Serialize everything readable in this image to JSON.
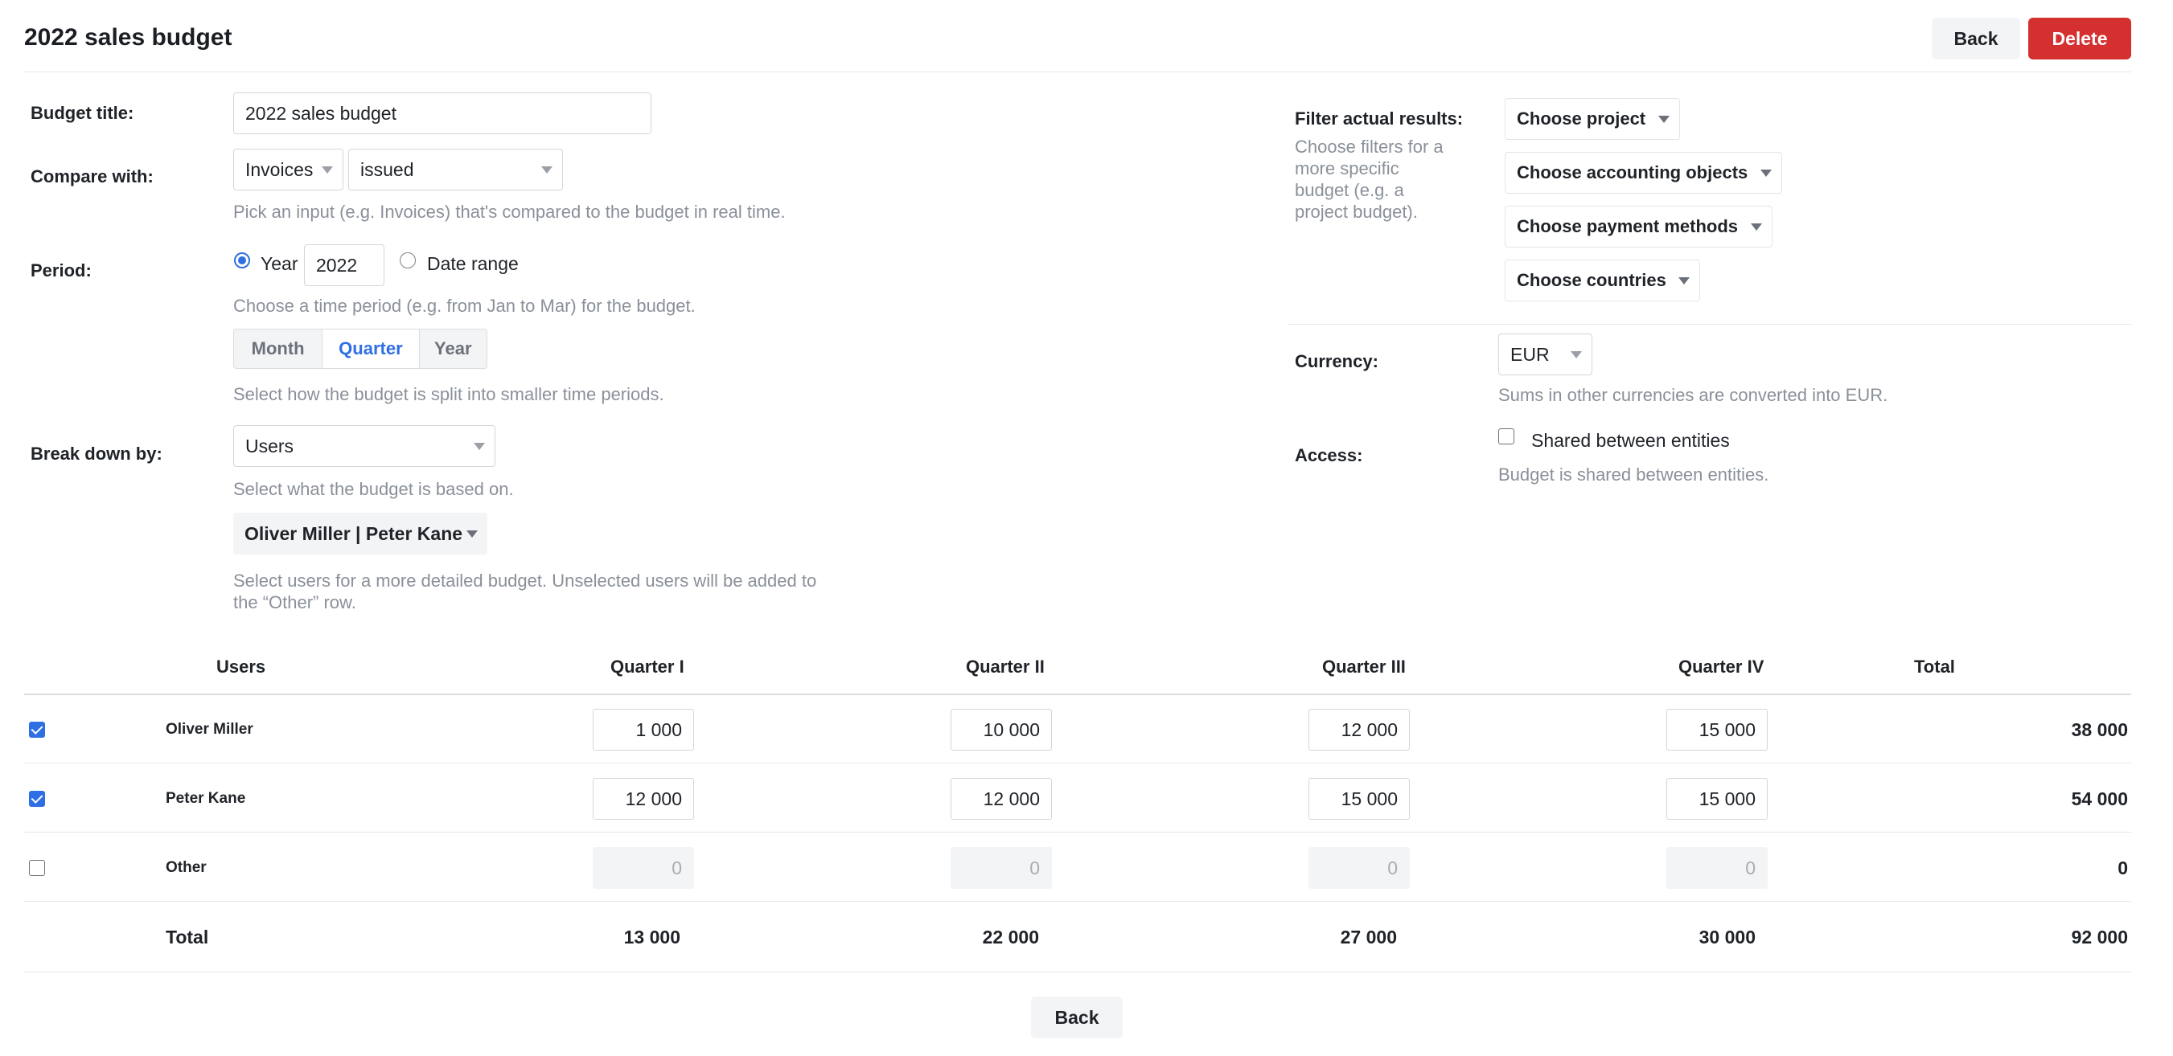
{
  "header": {
    "title": "2022 sales budget",
    "back_label": "Back",
    "delete_label": "Delete"
  },
  "form": {
    "budget_title": {
      "label": "Budget title:",
      "value": "2022 sales budget"
    },
    "compare_with": {
      "label": "Compare with:",
      "input_value": "Invoices",
      "status_value": "issued",
      "hint": "Pick an input (e.g. Invoices) that's compared to the budget in real time."
    },
    "period": {
      "label": "Period:",
      "year_option": "Year",
      "year_value": "2022",
      "date_range_option": "Date range",
      "selected": "year",
      "hint": "Choose a time period (e.g. from Jan to Mar) for the budget.",
      "split_options": [
        "Month",
        "Quarter",
        "Year"
      ],
      "split_selected": "Quarter",
      "split_hint": "Select how the budget is split into smaller time periods."
    },
    "break_down": {
      "label": "Break down by:",
      "value": "Users",
      "hint": "Select what the budget is based on.",
      "users_value": "Oliver Miller | Peter Kane",
      "users_hint": "Select users for a more detailed budget. Unselected users will be added to the “Other” row."
    }
  },
  "filters": {
    "label": "Filter actual results:",
    "hint": "Choose filters for a more specific budget (e.g. a project budget).",
    "buttons": [
      "Choose project",
      "Choose accounting objects",
      "Choose payment methods",
      "Choose countries"
    ]
  },
  "currency": {
    "label": "Currency:",
    "value": "EUR",
    "hint": "Sums in other currencies are converted into EUR."
  },
  "access": {
    "label": "Access:",
    "checkbox_label": "Shared between entities",
    "checked": false,
    "hint": "Budget is shared between entities."
  },
  "table": {
    "headers": [
      "Users",
      "Quarter I",
      "Quarter II",
      "Quarter III",
      "Quarter IV",
      "Total"
    ],
    "rows": [
      {
        "name": "Oliver Miller",
        "checked": true,
        "values": [
          "1 000",
          "10 000",
          "12 000",
          "15 000"
        ],
        "total": "38 000"
      },
      {
        "name": "Peter Kane",
        "checked": true,
        "values": [
          "12 000",
          "12 000",
          "15 000",
          "15 000"
        ],
        "total": "54 000"
      },
      {
        "name": "Other",
        "checked": false,
        "values": [
          "0",
          "0",
          "0",
          "0"
        ],
        "total": "0"
      }
    ],
    "totals": {
      "label": "Total",
      "values": [
        "13 000",
        "22 000",
        "27 000",
        "30 000"
      ],
      "grand_total": "92 000"
    }
  },
  "footer": {
    "back_label": "Back"
  },
  "colors": {
    "accent": "#2f6fe4",
    "danger": "#d3302f"
  }
}
